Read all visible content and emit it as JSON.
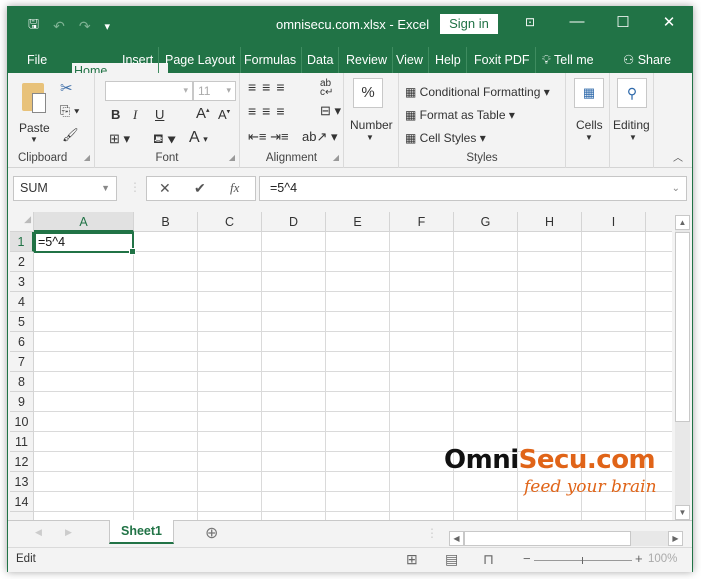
{
  "window": {
    "title": "omnisecu.com.xlsx  -  Excel",
    "sign_in": "Sign in",
    "controls": {
      "restore_ribbon": "⊼",
      "minimize": "—",
      "maximize": "☐",
      "close": "✕"
    }
  },
  "qat": {
    "save_icon": "💾",
    "undo_icon": "↶",
    "redo_icon": "↷",
    "customize_icon": "▾"
  },
  "tabs": [
    {
      "label": "File"
    },
    {
      "label": "Home",
      "active": true
    },
    {
      "label": "Insert"
    },
    {
      "label": "Page Layout"
    },
    {
      "label": "Formulas"
    },
    {
      "label": "Data"
    },
    {
      "label": "Review"
    },
    {
      "label": "View"
    },
    {
      "label": "Help"
    },
    {
      "label": "Foxit PDF"
    },
    {
      "label": "Tell me"
    },
    {
      "label": "Share"
    }
  ],
  "ribbon": {
    "clipboard": {
      "label": "Clipboard",
      "paste": "Paste"
    },
    "font": {
      "label": "Font",
      "font_name": "",
      "font_size": "11",
      "bold": "B",
      "italic": "I",
      "underline": "U"
    },
    "alignment": {
      "label": "Alignment"
    },
    "number": {
      "label": "Number",
      "percent": "%"
    },
    "styles": {
      "label": "Styles",
      "conditional_formatting": "Conditional Formatting",
      "format_as_table": "Format as Table",
      "cell_styles": "Cell Styles"
    },
    "cells": {
      "label": "Cells"
    },
    "editing": {
      "label": "Editing"
    }
  },
  "formula_bar": {
    "name_box": "SUM",
    "cancel": "✕",
    "enter": "✔",
    "fx": "fx",
    "formula": "=5^4"
  },
  "grid": {
    "columns": [
      "A",
      "B",
      "C",
      "D",
      "E",
      "F",
      "G",
      "H",
      "I"
    ],
    "rows": [
      "1",
      "2",
      "3",
      "4",
      "5",
      "6",
      "7",
      "8",
      "9",
      "10",
      "11",
      "12",
      "13",
      "14"
    ],
    "active_cell": {
      "ref": "A1",
      "value": "=5^4"
    }
  },
  "sheets": [
    {
      "name": "Sheet1",
      "active": true
    }
  ],
  "status": {
    "mode": "Edit",
    "zoom": "100%"
  },
  "watermark": {
    "part1": "Omni",
    "part2": "Secu.com",
    "tagline": "feed your brain"
  },
  "colors": {
    "accent": "#217346",
    "logo_orange": "#e06418"
  }
}
